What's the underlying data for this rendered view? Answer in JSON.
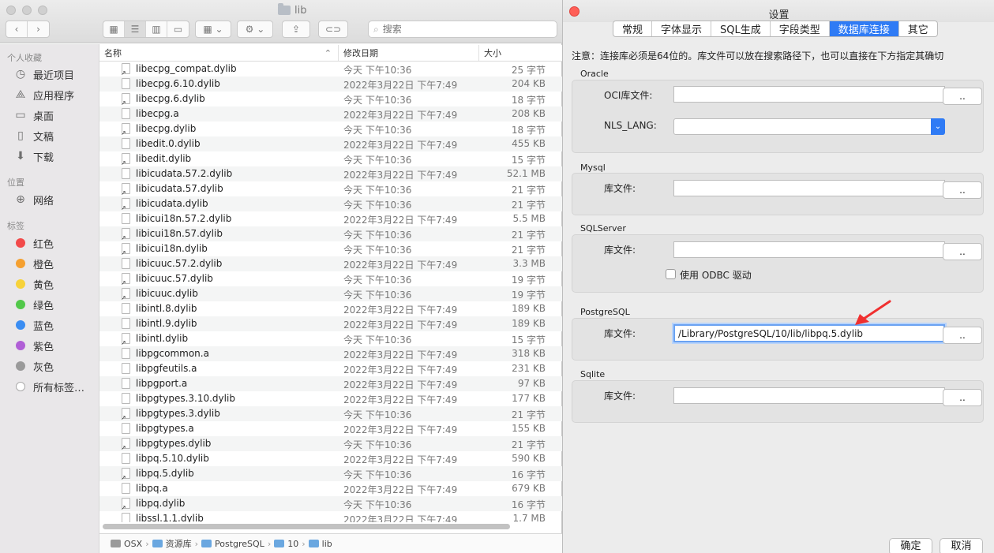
{
  "finder": {
    "title": "lib",
    "search_placeholder": "搜索",
    "columns": {
      "name": "名称",
      "date": "修改日期",
      "size": "大小"
    },
    "sidebar": {
      "favorites_header": "个人收藏",
      "favorites": [
        "最近项目",
        "应用程序",
        "桌面",
        "文稿",
        "下载"
      ],
      "locations_header": "位置",
      "locations": [
        "网络"
      ],
      "tags_header": "标签",
      "tags": [
        {
          "label": "红色",
          "color": "#f24a4a"
        },
        {
          "label": "橙色",
          "color": "#f5a030"
        },
        {
          "label": "黄色",
          "color": "#f7d23a"
        },
        {
          "label": "绿色",
          "color": "#52c84a"
        },
        {
          "label": "蓝色",
          "color": "#3a8df2"
        },
        {
          "label": "紫色",
          "color": "#b05fd6"
        },
        {
          "label": "灰色",
          "color": "#9a9a9a"
        },
        {
          "label": "所有标签…",
          "color": ""
        }
      ]
    },
    "files": [
      {
        "name": "libecpg_compat.dylib",
        "date": "今天 下午10:36",
        "size": "25 字节",
        "alias": true
      },
      {
        "name": "libecpg.6.10.dylib",
        "date": "2022年3月22日 下午7:49",
        "size": "204 KB",
        "alias": false
      },
      {
        "name": "libecpg.6.dylib",
        "date": "今天 下午10:36",
        "size": "18 字节",
        "alias": true
      },
      {
        "name": "libecpg.a",
        "date": "2022年3月22日 下午7:49",
        "size": "208 KB",
        "alias": false
      },
      {
        "name": "libecpg.dylib",
        "date": "今天 下午10:36",
        "size": "18 字节",
        "alias": true
      },
      {
        "name": "libedit.0.dylib",
        "date": "2022年3月22日 下午7:49",
        "size": "455 KB",
        "alias": false
      },
      {
        "name": "libedit.dylib",
        "date": "今天 下午10:36",
        "size": "15 字节",
        "alias": true
      },
      {
        "name": "libicudata.57.2.dylib",
        "date": "2022年3月22日 下午7:49",
        "size": "52.1 MB",
        "alias": false
      },
      {
        "name": "libicudata.57.dylib",
        "date": "今天 下午10:36",
        "size": "21 字节",
        "alias": true
      },
      {
        "name": "libicudata.dylib",
        "date": "今天 下午10:36",
        "size": "21 字节",
        "alias": true
      },
      {
        "name": "libicui18n.57.2.dylib",
        "date": "2022年3月22日 下午7:49",
        "size": "5.5 MB",
        "alias": false
      },
      {
        "name": "libicui18n.57.dylib",
        "date": "今天 下午10:36",
        "size": "21 字节",
        "alias": true
      },
      {
        "name": "libicui18n.dylib",
        "date": "今天 下午10:36",
        "size": "21 字节",
        "alias": true
      },
      {
        "name": "libicuuc.57.2.dylib",
        "date": "2022年3月22日 下午7:49",
        "size": "3.3 MB",
        "alias": false
      },
      {
        "name": "libicuuc.57.dylib",
        "date": "今天 下午10:36",
        "size": "19 字节",
        "alias": true
      },
      {
        "name": "libicuuc.dylib",
        "date": "今天 下午10:36",
        "size": "19 字节",
        "alias": true
      },
      {
        "name": "libintl.8.dylib",
        "date": "2022年3月22日 下午7:49",
        "size": "189 KB",
        "alias": false
      },
      {
        "name": "libintl.9.dylib",
        "date": "2022年3月22日 下午7:49",
        "size": "189 KB",
        "alias": false
      },
      {
        "name": "libintl.dylib",
        "date": "今天 下午10:36",
        "size": "15 字节",
        "alias": true
      },
      {
        "name": "libpgcommon.a",
        "date": "2022年3月22日 下午7:49",
        "size": "318 KB",
        "alias": false
      },
      {
        "name": "libpgfeutils.a",
        "date": "2022年3月22日 下午7:49",
        "size": "231 KB",
        "alias": false
      },
      {
        "name": "libpgport.a",
        "date": "2022年3月22日 下午7:49",
        "size": "97 KB",
        "alias": false
      },
      {
        "name": "libpgtypes.3.10.dylib",
        "date": "2022年3月22日 下午7:49",
        "size": "177 KB",
        "alias": false
      },
      {
        "name": "libpgtypes.3.dylib",
        "date": "今天 下午10:36",
        "size": "21 字节",
        "alias": true
      },
      {
        "name": "libpgtypes.a",
        "date": "2022年3月22日 下午7:49",
        "size": "155 KB",
        "alias": false
      },
      {
        "name": "libpgtypes.dylib",
        "date": "今天 下午10:36",
        "size": "21 字节",
        "alias": true
      },
      {
        "name": "libpq.5.10.dylib",
        "date": "2022年3月22日 下午7:49",
        "size": "590 KB",
        "alias": false
      },
      {
        "name": "libpq.5.dylib",
        "date": "今天 下午10:36",
        "size": "16 字节",
        "alias": true
      },
      {
        "name": "libpq.a",
        "date": "2022年3月22日 下午7:49",
        "size": "679 KB",
        "alias": false
      },
      {
        "name": "libpq.dylib",
        "date": "今天 下午10:36",
        "size": "16 字节",
        "alias": true
      },
      {
        "name": "libssl.1.1.dylib",
        "date": "2022年3月22日 下午7:49",
        "size": "1.7 MB",
        "alias": false
      }
    ],
    "pathbar": [
      "OSX",
      "资源库",
      "PostgreSQL",
      "10",
      "lib"
    ]
  },
  "dialog": {
    "title": "设置",
    "tabs": [
      "常规",
      "字体显示",
      "SQL生成",
      "字段类型",
      "数据库连接",
      "其它"
    ],
    "active_tab": "数据库连接",
    "accent_color": "#2f7bf5",
    "notice": "注意：连接库必须是64位的。库文件可以放在搜索路径下，也可以直接在下方指定其确切",
    "oracle": {
      "label": "Oracle",
      "oci_label": "OCI库文件:",
      "oci_value": "",
      "nls_label": "NLS_LANG:",
      "nls_value": ""
    },
    "mysql": {
      "label": "Mysql",
      "lib_label": "库文件:",
      "lib_value": ""
    },
    "sqlserver": {
      "label": "SQLServer",
      "lib_label": "库文件:",
      "lib_value": "",
      "odbc_label": "使用 ODBC 驱动"
    },
    "postgresql": {
      "label": "PostgreSQL",
      "lib_label": "库文件:",
      "lib_value": "/Library/PostgreSQL/10/lib/libpq.5.dylib"
    },
    "sqlite": {
      "label": "Sqlite",
      "lib_label": "库文件:",
      "lib_value": ""
    },
    "browse_label": "..",
    "ok_label": "确定",
    "cancel_label": "取消"
  }
}
